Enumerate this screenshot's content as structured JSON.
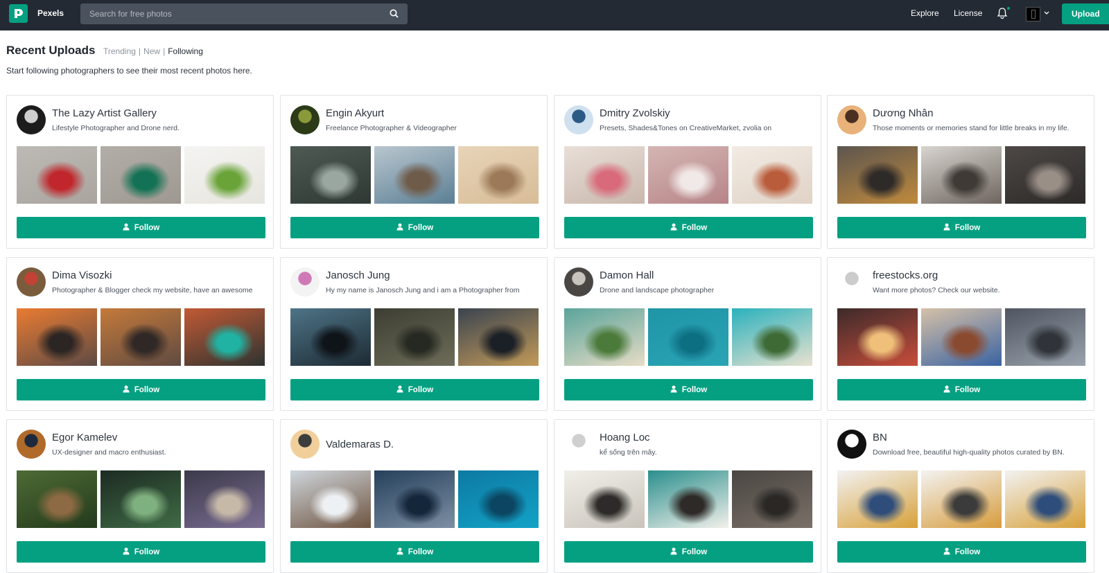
{
  "nav": {
    "brand": "Pexels",
    "search_placeholder": "Search for free photos",
    "explore": "Explore",
    "license": "License",
    "upload": "Upload"
  },
  "page": {
    "title": "Recent Uploads",
    "tabs": [
      {
        "label": "Trending"
      },
      {
        "label": "New"
      },
      {
        "label": "Following"
      }
    ],
    "active_tab": "Following",
    "subtitle": "Start following photographers to see their most recent photos here."
  },
  "follow_label": "Follow",
  "colors": {
    "accent": "#05a081",
    "nav_bg": "#232a34",
    "search_bg": "#4a525d"
  },
  "photographers": [
    {
      "name": "The Lazy Artist Gallery",
      "bio": "Lifestyle Photographer and Drone nerd.",
      "avatar": [
        "#1c1c1c",
        "#cfcfcf"
      ],
      "photos": [
        [
          "#bdbab5",
          "#a9a49e",
          "#c0262b"
        ],
        [
          "#b2aea7",
          "#9e9891",
          "#137255"
        ],
        [
          "#f4f4f2",
          "#e7e5df",
          "#6aa439"
        ]
      ]
    },
    {
      "name": "Engin Akyurt",
      "bio": "Freelance Photographer & Videographer",
      "avatar": [
        "#2c3a18",
        "#8a9a3a"
      ],
      "photos": [
        [
          "#4d5a52",
          "#2f3834",
          "#9aa6a0"
        ],
        [
          "#b9c6cf",
          "#5b7f94",
          "#6f5b49"
        ],
        [
          "#e8d4b9",
          "#d7bc96",
          "#9c7a59"
        ]
      ]
    },
    {
      "name": "Dmitry Zvolskiy",
      "bio": "Presets, Shades&Tones on CreativeMarket, zvolia on",
      "avatar": [
        "#cfe0ee",
        "#2b5a86"
      ],
      "photos": [
        [
          "#e8dfd8",
          "#c9b7ac",
          "#d86a7b"
        ],
        [
          "#d4b6b3",
          "#b78488",
          "#f1e9e7"
        ],
        [
          "#f2ece4",
          "#e0d2c6",
          "#b95c3b"
        ]
      ]
    },
    {
      "name": "Dương Nhân",
      "bio": "Those moments or memories stand for little breaks in my life.",
      "avatar": [
        "#e8b27a",
        "#4b3022"
      ],
      "photos": [
        [
          "#5c554f",
          "#c08a3c",
          "#2d2a28"
        ],
        [
          "#d8d4cf",
          "#6e6560",
          "#3f3a36"
        ],
        [
          "#4d4846",
          "#2d2a28",
          "#9a8f87"
        ]
      ]
    },
    {
      "name": "Dima Visozki",
      "bio": "Photographer & Blogger check my website, have an awesome",
      "avatar": [
        "#7a5c3c",
        "#c24236"
      ],
      "photos": [
        [
          "#ea7c31",
          "#5d4a45",
          "#2b2524"
        ],
        [
          "#c57a3a",
          "#5f4a41",
          "#2f2826"
        ],
        [
          "#c25a35",
          "#2e3331",
          "#20b3a3"
        ]
      ]
    },
    {
      "name": "Janosch Jung",
      "bio": "Hy my name is Janosch Jung and i am a Photographer from",
      "avatar": [
        "#f3f3f3",
        "#cf7ab6"
      ],
      "photos": [
        [
          "#4e7487",
          "#1d2a33",
          "#0f1419"
        ],
        [
          "#3d3f33",
          "#6d6c58",
          "#262921"
        ],
        [
          "#3b4450",
          "#c29a58",
          "#1b1f26"
        ]
      ]
    },
    {
      "name": "Damon Hall",
      "bio": "Drone and landscape photographer",
      "avatar": [
        "#4a4644",
        "#c9c3bd"
      ],
      "photos": [
        [
          "#5aa49b",
          "#e7dcc6",
          "#4b7a3a"
        ],
        [
          "#1f95a6",
          "#2aa4b5",
          "#0d6f82"
        ],
        [
          "#2bb1bd",
          "#e9e2cf",
          "#3e6a35"
        ]
      ]
    },
    {
      "name": "freestocks.org",
      "bio": "Want more photos? Check our website.",
      "avatar": [
        "#ffffff",
        "#cccccc"
      ],
      "photos": [
        [
          "#3c2a2a",
          "#c84d3b",
          "#f0c07a"
        ],
        [
          "#d6c1a8",
          "#3a63a2",
          "#8a4a2f"
        ],
        [
          "#4f5560",
          "#9aa3ad",
          "#30343a"
        ]
      ]
    },
    {
      "name": "Egor Kamelev",
      "bio": "UX-designer and macro enthusiast.",
      "avatar": [
        "#b06a2a",
        "#1d2a3d"
      ],
      "photos": [
        [
          "#4e6a34",
          "#233a1c",
          "#8d6a43"
        ],
        [
          "#1d2b22",
          "#3f6b46",
          "#7fb07f"
        ],
        [
          "#3c3a4a",
          "#7a6d92",
          "#c7b9a8"
        ]
      ]
    },
    {
      "name": "Valdemaras D.",
      "bio": "",
      "avatar": [
        "#f1cf9a",
        "#3d3d3d"
      ],
      "photos": [
        [
          "#cfd6dc",
          "#6e5440",
          "#eef1f4"
        ],
        [
          "#26415c",
          "#7d8fa4",
          "#14263a"
        ],
        [
          "#0d7aa3",
          "#13a2c6",
          "#0b4561"
        ]
      ]
    },
    {
      "name": "Hoang Loc",
      "bio": "kể sống trên mây.",
      "avatar": [
        "#ffffff",
        "#cfcfcf"
      ],
      "photos": [
        [
          "#f1efe9",
          "#c9c4bb",
          "#2d2b29"
        ],
        [
          "#2a8f8d",
          "#f3f0ea",
          "#2e2a27"
        ],
        [
          "#4a4642",
          "#7a7067",
          "#2a2725"
        ]
      ]
    },
    {
      "name": "BN",
      "bio": "Download free, beautiful high-quality photos curated by BN.",
      "avatar": [
        "#111111",
        "#ffffff"
      ],
      "photos": [
        [
          "#f2f2f2",
          "#d7a13a",
          "#2f4d7a"
        ],
        [
          "#f3f3f3",
          "#d79c3c",
          "#3b3b3b"
        ],
        [
          "#f2f2f2",
          "#d7a13a",
          "#2f4d7a"
        ]
      ]
    }
  ]
}
